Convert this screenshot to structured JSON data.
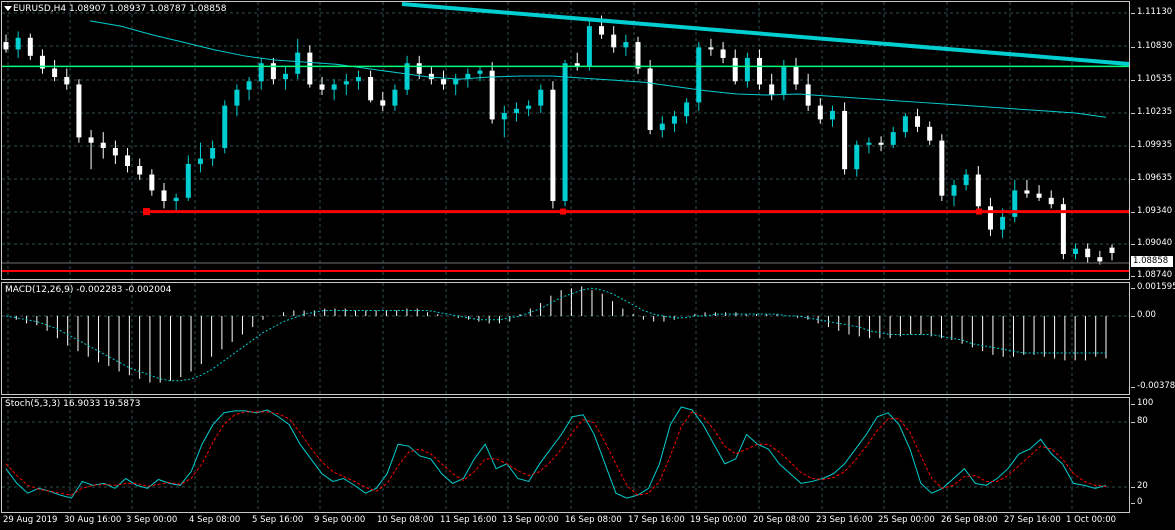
{
  "symbol_line": "EURUSD,H4  1.08907 1.08937 1.08787 1.08858",
  "macd_line": "MACD(12,26,9) -0.002283 -0.002004",
  "stoch_line": "Stoch(5,3,3) 16.9033 19.5873",
  "current_price": "1.08858",
  "price_ticks": [
    "1.11130",
    "1.10830",
    "1.10535",
    "1.10235",
    "1.09935",
    "1.09635",
    "1.09340",
    "1.09040",
    "1.08740"
  ],
  "macd_ticks": [
    "0.001595",
    "0.00",
    "-0.003788"
  ],
  "stoch_ticks": [
    "100",
    "80",
    "20",
    "0"
  ],
  "dates": [
    "29 Aug 2019",
    "30 Aug 16:00",
    "3 Sep 00:00",
    "4 Sep 08:00",
    "5 Sep 16:00",
    "9 Sep 00:00",
    "10 Sep 08:00",
    "11 Sep 16:00",
    "13 Sep 00:00",
    "16 Sep 08:00",
    "17 Sep 16:00",
    "19 Sep 00:00",
    "20 Sep 08:00",
    "23 Sep 16:00",
    "25 Sep 00:00",
    "26 Sep 08:00",
    "27 Sep 16:00",
    "1 Oct 00:00"
  ],
  "colors": {
    "bull": "#00ced1",
    "bear": "#ffffff",
    "support_line": "#ff0000",
    "resistance_line": "#00ff7f",
    "trend_line": "#00ced1",
    "ma_line": "#00ced1",
    "stoch_signal": "#ff0000",
    "grid": "#2f4f4f"
  },
  "chart_data": {
    "type": "candlestick",
    "price_range": [
      1.0868,
      1.1119
    ],
    "candles": [
      [
        1.1085,
        1.1092,
        1.1075,
        1.1078
      ],
      [
        1.1078,
        1.1095,
        1.107,
        1.1089
      ],
      [
        1.1089,
        1.1093,
        1.1068,
        1.1072
      ],
      [
        1.1072,
        1.1078,
        1.1055,
        1.106
      ],
      [
        1.106,
        1.1068,
        1.1048,
        1.1052
      ],
      [
        1.1052,
        1.106,
        1.104,
        1.1045
      ],
      [
        1.1045,
        1.105,
        1.099,
        1.0995
      ],
      [
        1.0995,
        1.1002,
        1.0965,
        1.099
      ],
      [
        1.099,
        1.1,
        1.0975,
        1.0985
      ],
      [
        1.0985,
        1.0992,
        1.097,
        1.0978
      ],
      [
        1.0978,
        1.0985,
        1.0962,
        1.0968
      ],
      [
        1.0968,
        1.0975,
        1.0955,
        1.096
      ],
      [
        1.096,
        1.0965,
        1.094,
        1.0945
      ],
      [
        1.0945,
        1.0952,
        1.0928,
        1.0935
      ],
      [
        1.0935,
        1.0942,
        1.0925,
        1.0938
      ],
      [
        1.0938,
        1.0978,
        1.0935,
        1.097
      ],
      [
        1.097,
        1.099,
        1.0962,
        1.0975
      ],
      [
        1.0975,
        1.0992,
        1.0968,
        1.0985
      ],
      [
        1.0985,
        1.103,
        1.098,
        1.1025
      ],
      [
        1.1025,
        1.1045,
        1.1015,
        1.104
      ],
      [
        1.104,
        1.1052,
        1.103,
        1.1048
      ],
      [
        1.1048,
        1.107,
        1.104,
        1.1065
      ],
      [
        1.1065,
        1.107,
        1.1045,
        1.105
      ],
      [
        1.105,
        1.1062,
        1.104,
        1.1055
      ],
      [
        1.1055,
        1.1088,
        1.105,
        1.1075
      ],
      [
        1.1075,
        1.1082,
        1.1042,
        1.1045
      ],
      [
        1.1045,
        1.1052,
        1.1035,
        1.104
      ],
      [
        1.104,
        1.105,
        1.103,
        1.1045
      ],
      [
        1.1045,
        1.1055,
        1.1035,
        1.1048
      ],
      [
        1.1048,
        1.1058,
        1.104,
        1.1052
      ],
      [
        1.1052,
        1.1058,
        1.1028,
        1.103
      ],
      [
        1.103,
        1.1038,
        1.102,
        1.1025
      ],
      [
        1.1025,
        1.1045,
        1.102,
        1.104
      ],
      [
        1.104,
        1.1072,
        1.1035,
        1.1065
      ],
      [
        1.1065,
        1.1072,
        1.105,
        1.1055
      ],
      [
        1.1055,
        1.1062,
        1.1045,
        1.105
      ],
      [
        1.105,
        1.1058,
        1.104,
        1.1045
      ],
      [
        1.1045,
        1.1055,
        1.1035,
        1.105
      ],
      [
        1.105,
        1.106,
        1.1042,
        1.1055
      ],
      [
        1.1055,
        1.1062,
        1.1048,
        1.1058
      ],
      [
        1.1058,
        1.1066,
        1.1008,
        1.1012
      ],
      [
        1.1012,
        1.1025,
        1.0995,
        1.1018
      ],
      [
        1.1018,
        1.1028,
        1.101,
        1.1022
      ],
      [
        1.1022,
        1.103,
        1.1015,
        1.1025
      ],
      [
        1.1025,
        1.1045,
        1.1018,
        1.104
      ],
      [
        1.104,
        1.1048,
        1.0928,
        1.0935
      ],
      [
        1.0935,
        1.1068,
        1.093,
        1.1065
      ],
      [
        1.1065,
        1.1075,
        1.1058,
        1.1062
      ],
      [
        1.1062,
        1.1108,
        1.1058,
        1.11
      ],
      [
        1.11,
        1.111,
        1.1088,
        1.1092
      ],
      [
        1.1092,
        1.11,
        1.1075,
        1.108
      ],
      [
        1.108,
        1.1092,
        1.1072,
        1.1085
      ],
      [
        1.1085,
        1.109,
        1.1055,
        1.106
      ],
      [
        1.106,
        1.1068,
        1.0998,
        1.1002
      ],
      [
        1.1002,
        1.1015,
        1.0995,
        1.1008
      ],
      [
        1.1008,
        1.102,
        1.1,
        1.1015
      ],
      [
        1.1015,
        1.1032,
        1.1008,
        1.1028
      ],
      [
        1.1028,
        1.1085,
        1.102,
        1.108
      ],
      [
        1.108,
        1.1088,
        1.1072,
        1.1078
      ],
      [
        1.1078,
        1.1085,
        1.1065,
        1.107
      ],
      [
        1.107,
        1.1078,
        1.1045,
        1.1048
      ],
      [
        1.1048,
        1.1075,
        1.1042,
        1.107
      ],
      [
        1.107,
        1.1078,
        1.104,
        1.1045
      ],
      [
        1.1045,
        1.1055,
        1.103,
        1.1035
      ],
      [
        1.1035,
        1.1068,
        1.103,
        1.1062
      ],
      [
        1.1062,
        1.107,
        1.104,
        1.1045
      ],
      [
        1.1045,
        1.1055,
        1.102,
        1.1025
      ],
      [
        1.1025,
        1.1032,
        1.1008,
        1.1012
      ],
      [
        1.1012,
        1.1025,
        1.1005,
        1.102
      ],
      [
        1.102,
        1.1028,
        1.096,
        1.0965
      ],
      [
        1.0965,
        1.0992,
        1.0958,
        1.0988
      ],
      [
        1.0988,
        1.0995,
        1.098,
        1.099
      ],
      [
        1.099,
        1.0996,
        1.0982,
        1.0988
      ],
      [
        1.0988,
        1.1005,
        1.0985,
        1.1
      ],
      [
        1.1,
        1.1018,
        1.0995,
        1.1015
      ],
      [
        1.1015,
        1.1022,
        1.1,
        1.1005
      ],
      [
        1.1005,
        1.101,
        1.0988,
        1.0992
      ],
      [
        1.0992,
        1.0998,
        1.0935,
        1.094
      ],
      [
        1.094,
        1.0955,
        1.093,
        1.095
      ],
      [
        1.095,
        1.0965,
        1.0945,
        1.096
      ],
      [
        1.096,
        1.0968,
        1.0925,
        1.093
      ],
      [
        1.093,
        1.0938,
        1.0902,
        1.0908
      ],
      [
        1.0908,
        1.0928,
        1.09,
        1.092
      ],
      [
        1.092,
        1.0955,
        1.0915,
        1.0945
      ],
      [
        1.0945,
        1.0955,
        1.0938,
        1.0942
      ],
      [
        1.0942,
        1.095,
        1.0935,
        1.0938
      ],
      [
        1.0938,
        1.0945,
        1.0928,
        1.0932
      ],
      [
        1.0932,
        1.0938,
        1.088,
        1.0885
      ],
      [
        1.0885,
        1.0895,
        1.088,
        1.089
      ],
      [
        1.089,
        1.0895,
        1.0877,
        1.0882
      ],
      [
        1.0882,
        1.0888,
        1.0875,
        1.0878
      ],
      [
        1.0891,
        1.0894,
        1.0879,
        1.0886
      ]
    ],
    "ma": [
      1.1105,
      1.11,
      1.1092,
      1.1085,
      1.1078,
      1.1072,
      1.1068,
      1.1066,
      1.1064,
      1.106,
      1.1056,
      1.1052,
      1.105,
      1.1052,
      1.1053,
      1.1053,
      1.1051,
      1.1049,
      1.1047,
      1.1043,
      1.1039,
      1.1036,
      1.1035,
      1.1036,
      1.1034,
      1.1032,
      1.103,
      1.1028,
      1.1026,
      1.1024,
      1.1022,
      1.102,
      1.1018,
      1.1014
    ],
    "support": 1.0925,
    "resistance": 1.1062,
    "trend_line": [
      [
        1.1119
      ],
      [
        1.1062
      ]
    ],
    "macd_hist": [
      0.0,
      -0.0002,
      -0.0004,
      -0.0005,
      -0.0008,
      -0.0012,
      -0.0016,
      -0.0019,
      -0.0022,
      -0.0025,
      -0.0027,
      -0.003,
      -0.0032,
      -0.0034,
      -0.0036,
      -0.0036,
      -0.0035,
      -0.0033,
      -0.003,
      -0.0026,
      -0.0022,
      -0.0018,
      -0.0014,
      -0.001,
      -0.0006,
      -0.0002,
      0.0,
      0.0002,
      0.0003,
      0.0003,
      0.0003,
      0.0004,
      0.0004,
      0.0004,
      0.0003,
      0.0003,
      0.0003,
      0.0003,
      0.0003,
      0.0004,
      0.0004,
      0.0002,
      0.0001,
      0.0,
      -0.0001,
      -0.0002,
      -0.0003,
      -0.0004,
      -0.0004,
      -0.0003,
      0.0001,
      0.0004,
      0.0007,
      0.0011,
      0.0014,
      0.0015,
      0.0016,
      0.0014,
      0.0012,
      0.0008,
      0.0004,
      0.0001,
      -0.0002,
      -0.0003,
      -0.0003,
      -0.0002,
      0.0,
      0.0001,
      0.0002,
      0.0002,
      0.0002,
      0.0002,
      0.0001,
      0.0001,
      0.0001,
      0.0001,
      0.0,
      -0.0001,
      -0.0002,
      -0.0004,
      -0.0006,
      -0.0008,
      -0.001,
      -0.0011,
      -0.0012,
      -0.0012,
      -0.0012,
      -0.0011,
      -0.001,
      -0.001,
      -0.0011,
      -0.0012,
      -0.0013,
      -0.0015,
      -0.0017,
      -0.0019,
      -0.0021,
      -0.0022,
      -0.0022,
      -0.0021,
      -0.0021,
      -0.0022,
      -0.0023,
      -0.0024,
      -0.0024,
      -0.0024,
      -0.0022,
      -0.0023
    ],
    "macd_signal": [
      0.0,
      -0.0001,
      -0.0002,
      -0.0003,
      -0.0005,
      -0.0007,
      -0.001,
      -0.0013,
      -0.0016,
      -0.0019,
      -0.0022,
      -0.0025,
      -0.0028,
      -0.003,
      -0.0032,
      -0.0034,
      -0.0035,
      -0.0035,
      -0.0034,
      -0.0032,
      -0.0029,
      -0.0025,
      -0.0021,
      -0.0017,
      -0.0013,
      -0.0009,
      -0.0006,
      -0.0003,
      -0.0001,
      0.0001,
      0.0002,
      0.0003,
      0.0003,
      0.0003,
      0.0003,
      0.0003,
      0.0003,
      0.0003,
      0.0003,
      0.0003,
      0.0003,
      0.0003,
      0.0002,
      0.0001,
      0.0,
      -0.0001,
      -0.0002,
      -0.0002,
      -0.0002,
      -0.0001,
      0.0,
      0.0002,
      0.0004,
      0.0007,
      0.001,
      0.0012,
      0.0014,
      0.0015,
      0.0014,
      0.0012,
      0.0009,
      0.0006,
      0.0003,
      0.0001,
      0.0,
      -0.0001,
      -0.0001,
      0.0,
      0.0,
      0.0001,
      0.0001,
      0.0001,
      0.0001,
      0.0001,
      0.0001,
      0.0001,
      0.0,
      0.0,
      -0.0001,
      -0.0002,
      -0.0003,
      -0.0004,
      -0.0005,
      -0.0006,
      -0.0008,
      -0.0009,
      -0.001,
      -0.001,
      -0.001,
      -0.001,
      -0.001,
      -0.0011,
      -0.0012,
      -0.0013,
      -0.0015,
      -0.0016,
      -0.0017,
      -0.0018,
      -0.0019,
      -0.002,
      -0.002,
      -0.002,
      -0.002,
      -0.002,
      -0.002,
      -0.002,
      -0.002,
      -0.002
    ],
    "stoch_k": [
      35,
      20,
      10,
      15,
      12,
      8,
      5,
      22,
      18,
      20,
      15,
      25,
      18,
      15,
      24,
      20,
      18,
      32,
      60,
      80,
      92,
      94,
      94,
      92,
      95,
      88,
      80,
      60,
      45,
      30,
      22,
      25,
      18,
      10,
      15,
      30,
      60,
      58,
      48,
      45,
      30,
      20,
      25,
      45,
      60,
      35,
      40,
      25,
      22,
      40,
      55,
      70,
      88,
      90,
      70,
      40,
      10,
      5,
      8,
      15,
      40,
      80,
      98,
      95,
      80,
      60,
      40,
      45,
      70,
      60,
      55,
      40,
      30,
      20,
      22,
      25,
      30,
      40,
      55,
      70,
      88,
      92,
      80,
      55,
      20,
      10,
      15,
      25,
      35,
      20,
      18,
      25,
      35,
      50,
      55,
      65,
      50,
      40,
      20,
      18,
      15,
      18
    ],
    "stoch_d": [
      40,
      28,
      18,
      14,
      12,
      10,
      8,
      15,
      18,
      19,
      18,
      20,
      20,
      17,
      19,
      21,
      19,
      25,
      40,
      62,
      80,
      90,
      93,
      93,
      93,
      91,
      86,
      72,
      56,
      42,
      32,
      27,
      22,
      16,
      12,
      20,
      38,
      52,
      55,
      50,
      40,
      30,
      23,
      32,
      45,
      45,
      40,
      33,
      28,
      32,
      42,
      55,
      72,
      85,
      82,
      62,
      40,
      18,
      8,
      10,
      22,
      48,
      78,
      93,
      88,
      75,
      58,
      50,
      55,
      60,
      60,
      52,
      42,
      31,
      25,
      24,
      26,
      32,
      44,
      58,
      74,
      86,
      86,
      72,
      48,
      25,
      15,
      18,
      27,
      28,
      22,
      22,
      28,
      38,
      48,
      58,
      55,
      45,
      30,
      22,
      18,
      17
    ]
  }
}
